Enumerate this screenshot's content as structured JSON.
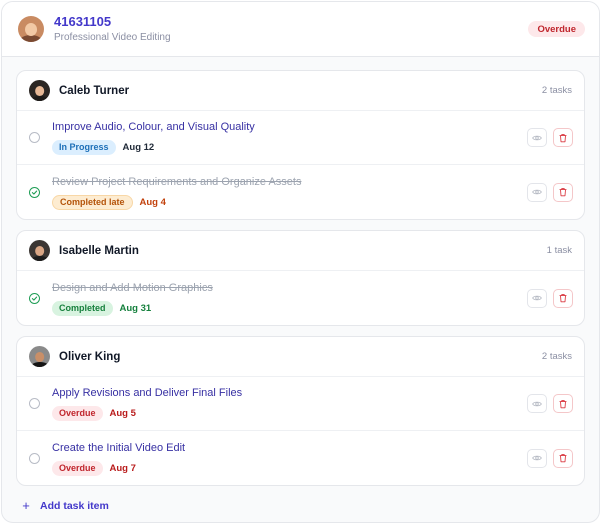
{
  "header": {
    "title": "41631105",
    "subtitle": "Professional Video Editing",
    "status": "Overdue"
  },
  "groups": [
    {
      "assignee": "Caleb Turner",
      "count": "2 tasks",
      "tasks": [
        {
          "title": "Improve Audio, Colour, and Visual Quality",
          "status": "In Progress",
          "due": "Aug 12",
          "done": false
        },
        {
          "title": "Review Project Requirements and Organize Assets",
          "status": "Completed late",
          "due": "Aug 4",
          "done": true
        }
      ]
    },
    {
      "assignee": "Isabelle Martin",
      "count": "1 task",
      "tasks": [
        {
          "title": "Design and Add Motion Graphics",
          "status": "Completed",
          "due": "Aug 31",
          "done": true
        }
      ]
    },
    {
      "assignee": "Oliver King",
      "count": "2 tasks",
      "tasks": [
        {
          "title": "Apply Revisions and Deliver Final Files",
          "status": "Overdue",
          "due": "Aug 5",
          "done": false
        },
        {
          "title": "Create the Initial Video Edit",
          "status": "Overdue",
          "due": "Aug 7",
          "done": false
        }
      ]
    }
  ],
  "add_task_label": "Add task item",
  "icons": {
    "view": "eye-icon",
    "delete": "trash-icon",
    "pending": "circle-icon",
    "done": "check-circle-icon",
    "add": "plus-icon"
  },
  "colors": {
    "accent": "#4338ca",
    "overdue": "#c0262d",
    "in_progress": "#1d6fb8",
    "completed_late": "#b45309",
    "completed": "#17803d"
  }
}
